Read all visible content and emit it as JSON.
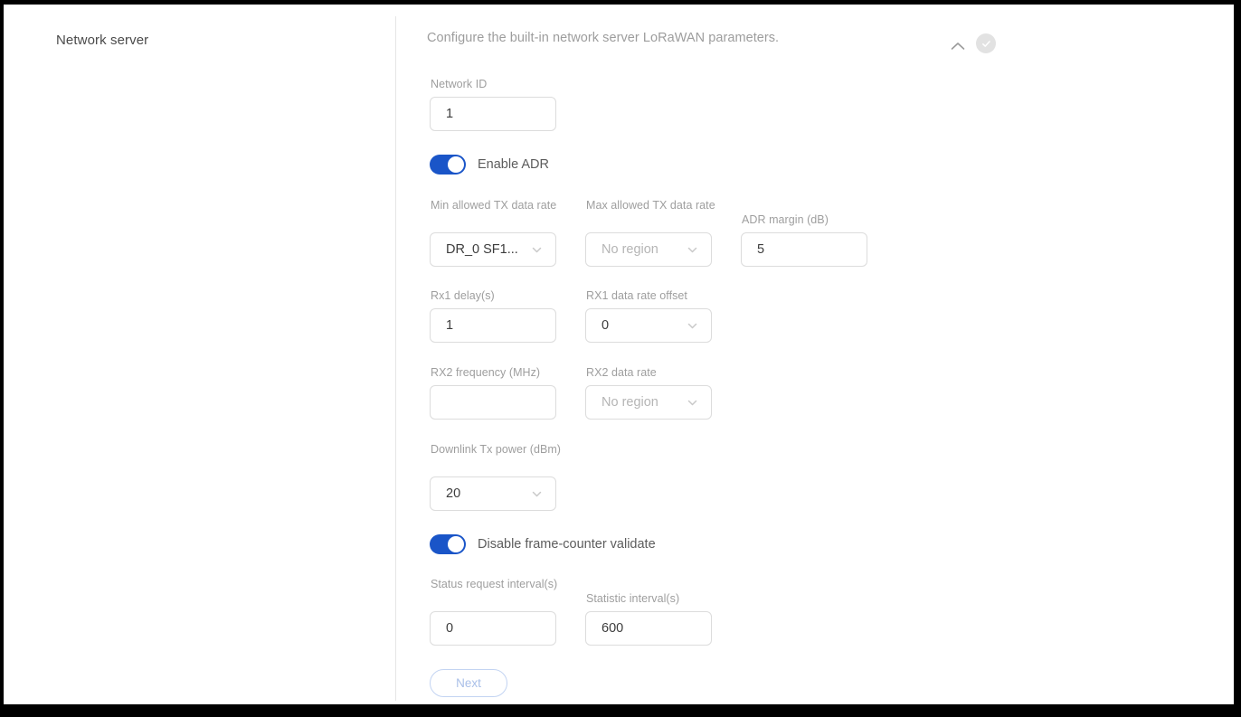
{
  "sidebar": {
    "section_title": "Network server"
  },
  "header": {
    "description": "Configure the built-in network server LoRaWAN parameters.",
    "collapse_icon": "chevron-up-icon",
    "status_icon": "check-circle-icon",
    "status_color": "#e2e2e2"
  },
  "theme": {
    "accent": "#1a55c8",
    "border": "#dcdcdc",
    "label": "#9e9e9e",
    "value": "#3c3c3c",
    "placeholder": "#b5b5b5",
    "next_border": "#c3d4f2",
    "next_text": "#a9bfe8"
  },
  "form": {
    "network_id": {
      "label": "Network ID",
      "value": "1"
    },
    "enable_adr": {
      "label": "Enable ADR",
      "state": "on"
    },
    "min_tx_data_rate": {
      "label": "Min allowed TX data rate",
      "value": "DR_0 SF1...",
      "is_placeholder": false
    },
    "max_tx_data_rate": {
      "label": "Max allowed TX data rate",
      "value": "No region",
      "is_placeholder": true
    },
    "adr_margin": {
      "label": "ADR margin (dB)",
      "value": "5"
    },
    "rx1_delay": {
      "label": "Rx1 delay(s)",
      "value": "1"
    },
    "rx1_data_rate_offset": {
      "label": "RX1 data rate offset",
      "value": "0",
      "is_placeholder": false
    },
    "rx2_frequency": {
      "label": "RX2 frequency (MHz)",
      "value": ""
    },
    "rx2_data_rate": {
      "label": "RX2 data rate",
      "value": "No region",
      "is_placeholder": true
    },
    "downlink_tx_power": {
      "label": "Downlink Tx power (dBm)",
      "value": "20",
      "is_placeholder": false
    },
    "disable_frame_counter": {
      "label": "Disable frame-counter validate",
      "state": "on"
    },
    "status_request_interval": {
      "label": "Status request interval(s)",
      "value": "0"
    },
    "statistic_interval": {
      "label": "Statistic interval(s)",
      "value": "600"
    }
  },
  "actions": {
    "next_label": "Next"
  }
}
